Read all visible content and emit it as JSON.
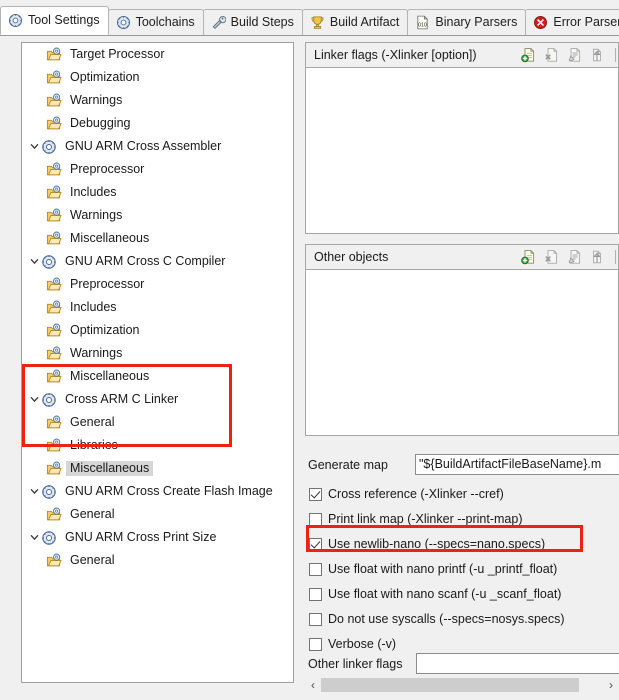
{
  "window": {
    "title": "Tool Settings",
    "background": "#f0f0f0",
    "accent_red": "#ee2211",
    "selection_gray": "#d6d6d6"
  },
  "tabs": [
    {
      "label": "Tool Settings",
      "icon": "gear-icon",
      "active": true
    },
    {
      "label": "Toolchains",
      "icon": "gear-icon",
      "active": false
    },
    {
      "label": "Build Steps",
      "icon": "wrench-icon",
      "active": false
    },
    {
      "label": "Build Artifact",
      "icon": "trophy-icon",
      "active": false
    },
    {
      "label": "Binary Parsers",
      "icon": "binary-document-icon",
      "active": false
    },
    {
      "label": "Error Parsers",
      "icon": "error-circle-icon",
      "active": false
    }
  ],
  "tree": {
    "items": [
      {
        "label": "Target Processor",
        "level": 1,
        "icon": "settings-folder-icon",
        "twisty": "",
        "selected": false
      },
      {
        "label": "Optimization",
        "level": 1,
        "icon": "settings-folder-icon",
        "twisty": "",
        "selected": false
      },
      {
        "label": "Warnings",
        "level": 1,
        "icon": "settings-folder-icon",
        "twisty": "",
        "selected": false
      },
      {
        "label": "Debugging",
        "level": 1,
        "icon": "settings-folder-icon",
        "twisty": "",
        "selected": false
      },
      {
        "label": "GNU ARM Cross Assembler",
        "level": 0,
        "icon": "gear-icon",
        "twisty": "v",
        "selected": false
      },
      {
        "label": "Preprocessor",
        "level": 1,
        "icon": "settings-folder-icon",
        "twisty": "",
        "selected": false
      },
      {
        "label": "Includes",
        "level": 1,
        "icon": "settings-folder-icon",
        "twisty": "",
        "selected": false
      },
      {
        "label": "Warnings",
        "level": 1,
        "icon": "settings-folder-icon",
        "twisty": "",
        "selected": false
      },
      {
        "label": "Miscellaneous",
        "level": 1,
        "icon": "settings-folder-icon",
        "twisty": "",
        "selected": false
      },
      {
        "label": "GNU ARM Cross C Compiler",
        "level": 0,
        "icon": "gear-icon",
        "twisty": "v",
        "selected": false
      },
      {
        "label": "Preprocessor",
        "level": 1,
        "icon": "settings-folder-icon",
        "twisty": "",
        "selected": false
      },
      {
        "label": "Includes",
        "level": 1,
        "icon": "settings-folder-icon",
        "twisty": "",
        "selected": false
      },
      {
        "label": "Optimization",
        "level": 1,
        "icon": "settings-folder-icon",
        "twisty": "",
        "selected": false
      },
      {
        "label": "Warnings",
        "level": 1,
        "icon": "settings-folder-icon",
        "twisty": "",
        "selected": false
      },
      {
        "label": "Miscellaneous",
        "level": 1,
        "icon": "settings-folder-icon",
        "twisty": "",
        "selected": false
      },
      {
        "label": "Cross ARM C Linker",
        "level": 0,
        "icon": "gear-icon",
        "twisty": "v",
        "selected": false
      },
      {
        "label": "General",
        "level": 1,
        "icon": "settings-folder-icon",
        "twisty": "",
        "selected": false
      },
      {
        "label": "Libraries",
        "level": 1,
        "icon": "settings-folder-icon",
        "twisty": "",
        "selected": false
      },
      {
        "label": "Miscellaneous",
        "level": 1,
        "icon": "settings-folder-icon",
        "twisty": "",
        "selected": true
      },
      {
        "label": "GNU ARM Cross Create Flash Image",
        "level": 0,
        "icon": "gear-icon",
        "twisty": "v",
        "selected": false
      },
      {
        "label": "General",
        "level": 1,
        "icon": "settings-folder-icon",
        "twisty": "",
        "selected": false
      },
      {
        "label": "GNU ARM Cross Print Size",
        "level": 0,
        "icon": "gear-icon",
        "twisty": "v",
        "selected": false
      },
      {
        "label": "General",
        "level": 1,
        "icon": "settings-folder-icon",
        "twisty": "",
        "selected": false
      }
    ]
  },
  "right": {
    "linker_flags_group": {
      "title": "Linker flags (-Xlinker [option])",
      "items": [],
      "tools": [
        {
          "name": "add-item-icon",
          "enabled": true
        },
        {
          "name": "delete-item-icon",
          "enabled": false
        },
        {
          "name": "edit-item-icon",
          "enabled": false
        },
        {
          "name": "move-up-icon",
          "enabled": false
        }
      ]
    },
    "other_objects_group": {
      "title": "Other objects",
      "items": [],
      "tools": [
        {
          "name": "add-item-icon",
          "enabled": true
        },
        {
          "name": "delete-item-icon",
          "enabled": false
        },
        {
          "name": "edit-item-icon",
          "enabled": false
        },
        {
          "name": "move-up-icon",
          "enabled": false
        }
      ]
    },
    "generate_map": {
      "label": "Generate map",
      "value": "\"${BuildArtifactFileBaseName}.m",
      "placeholder": ""
    },
    "checkboxes": [
      {
        "label": "Cross reference (-Xlinker --cref)",
        "checked": true,
        "highlighted": false
      },
      {
        "label": "Print link map (-Xlinker --print-map)",
        "checked": false,
        "highlighted": false
      },
      {
        "label": "Use newlib-nano (--specs=nano.specs)",
        "checked": true,
        "highlighted": true
      },
      {
        "label": "Use float with nano printf (-u _printf_float)",
        "checked": false,
        "highlighted": false
      },
      {
        "label": "Use float with nano scanf (-u _scanf_float)",
        "checked": false,
        "highlighted": false
      },
      {
        "label": "Do not use syscalls (--specs=nosys.specs)",
        "checked": false,
        "highlighted": false
      },
      {
        "label": "Verbose (-v)",
        "checked": false,
        "highlighted": false
      }
    ],
    "other_linker_flags": {
      "label": "Other linker flags",
      "value": "",
      "placeholder": ""
    },
    "hscroll": {
      "left_arrow": "‹",
      "right_arrow": "›"
    }
  }
}
